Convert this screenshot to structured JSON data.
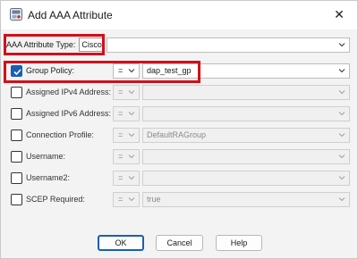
{
  "window": {
    "title": "Add AAA Attribute",
    "icons": {
      "app": "aaa-attribute-icon",
      "close": "close-icon"
    },
    "close_glyph": "✕"
  },
  "attribute_type": {
    "label": "AAA Attribute Type:",
    "value": "Cisco"
  },
  "rows": [
    {
      "label": "Group Policy:",
      "checked": true,
      "operator": "=",
      "value": "dap_test_gp",
      "enabled": true
    },
    {
      "label": "Assigned IPv4 Address:",
      "checked": false,
      "operator": "=",
      "value": "",
      "enabled": false
    },
    {
      "label": "Assigned IPv6 Address:",
      "checked": false,
      "operator": "=",
      "value": "",
      "enabled": false
    },
    {
      "label": "Connection Profile:",
      "checked": false,
      "operator": "=",
      "value": "DefaultRAGroup",
      "enabled": false
    },
    {
      "label": "Username:",
      "checked": false,
      "operator": "=",
      "value": "",
      "enabled": false
    },
    {
      "label": "Username2:",
      "checked": false,
      "operator": "=",
      "value": "",
      "enabled": false
    },
    {
      "label": "SCEP Required:",
      "checked": false,
      "operator": "=",
      "value": "true",
      "enabled": false
    }
  ],
  "buttons": {
    "ok": "OK",
    "cancel": "Cancel",
    "help": "Help"
  },
  "colors": {
    "highlight": "#d0101a",
    "accent": "#1a5fb4"
  }
}
